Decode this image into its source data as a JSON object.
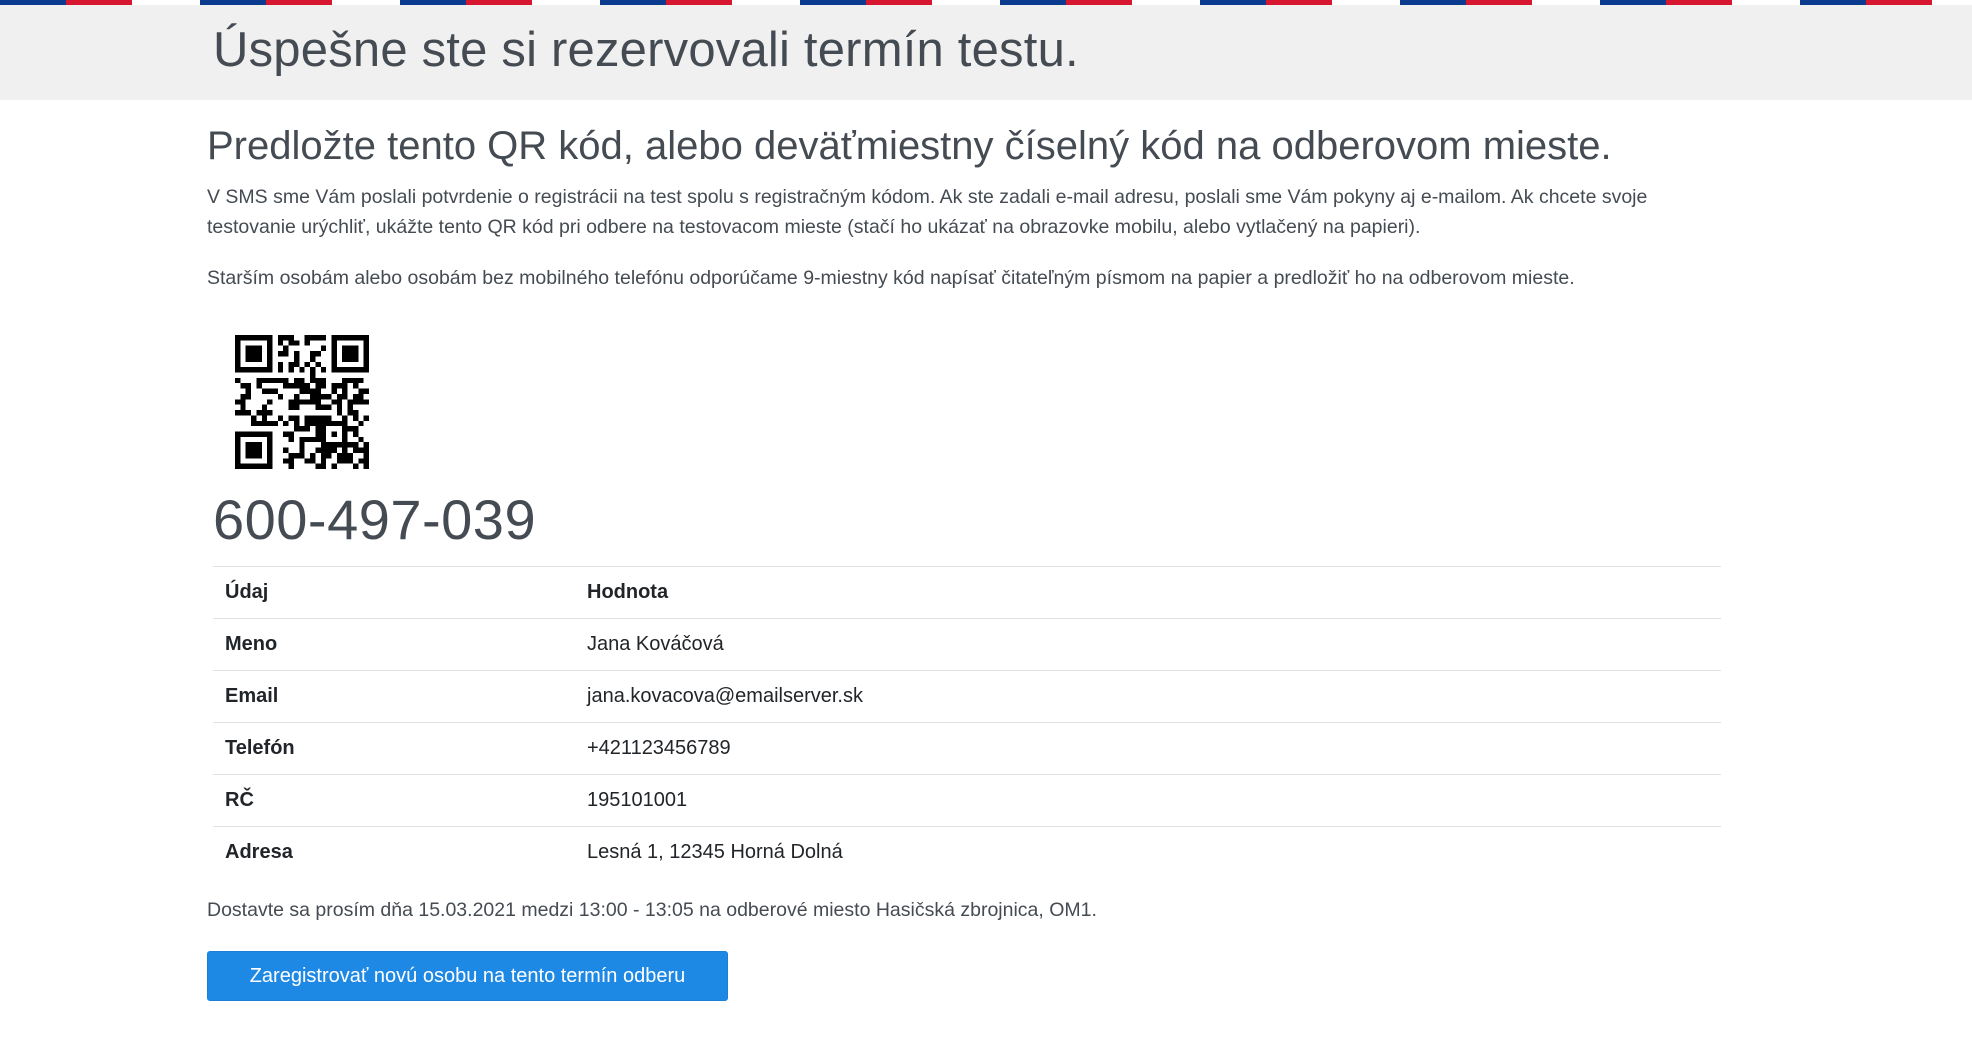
{
  "banner": {
    "title": "Úspešne ste si rezervovali termín testu."
  },
  "main": {
    "subtitle": "Predložte tento QR kód, alebo deväťmiestny číselný kód na odberovom mieste.",
    "paragraph_1": "V SMS sme Vám poslali potvrdenie o registrácii na test spolu s registračným kódom. Ak ste zadali e-mail adresu, poslali sme Vám pokyny aj e-mailom. Ak chcete svoje testovanie urýchliť, ukážte tento QR kód pri odbere na testovacom mieste (stačí ho ukázať na obrazovke mobilu, alebo vytlačený na papieri).",
    "paragraph_2": "Starším osobám alebo osobám bez mobilného telefónu odporúčame 9-miestny kód napísať čitateľným písmom na papier a predložiť ho na odberovom mieste.",
    "qr_icon": "qr-code-icon",
    "registration_code": "600-497-039"
  },
  "table": {
    "headers": [
      "Údaj",
      "Hodnota"
    ],
    "rows": [
      {
        "key": "Meno",
        "value": "Jana Kováčová"
      },
      {
        "key": "Email",
        "value": "jana.kovacova@emailserver.sk"
      },
      {
        "key": "Telefón",
        "value": "+421123456789"
      },
      {
        "key": "RČ",
        "value": "195101001"
      },
      {
        "key": "Adresa",
        "value": "Lesná 1, 12345 Horná Dolná"
      }
    ]
  },
  "appointment_text": "Dostavte sa prosím dňa 15.03.2021 medzi 13:00 - 13:05 na odberové miesto Hasičská zbrojnica, OM1.",
  "register_button_label": "Zaregistrovať novú osobu na tento termín odberu",
  "colors": {
    "flag_blue": "#0b3b8f",
    "flag_red": "#d7172f",
    "banner_bg": "#f0f0f0",
    "button_bg": "#1e88e5",
    "text": "#454b52"
  }
}
